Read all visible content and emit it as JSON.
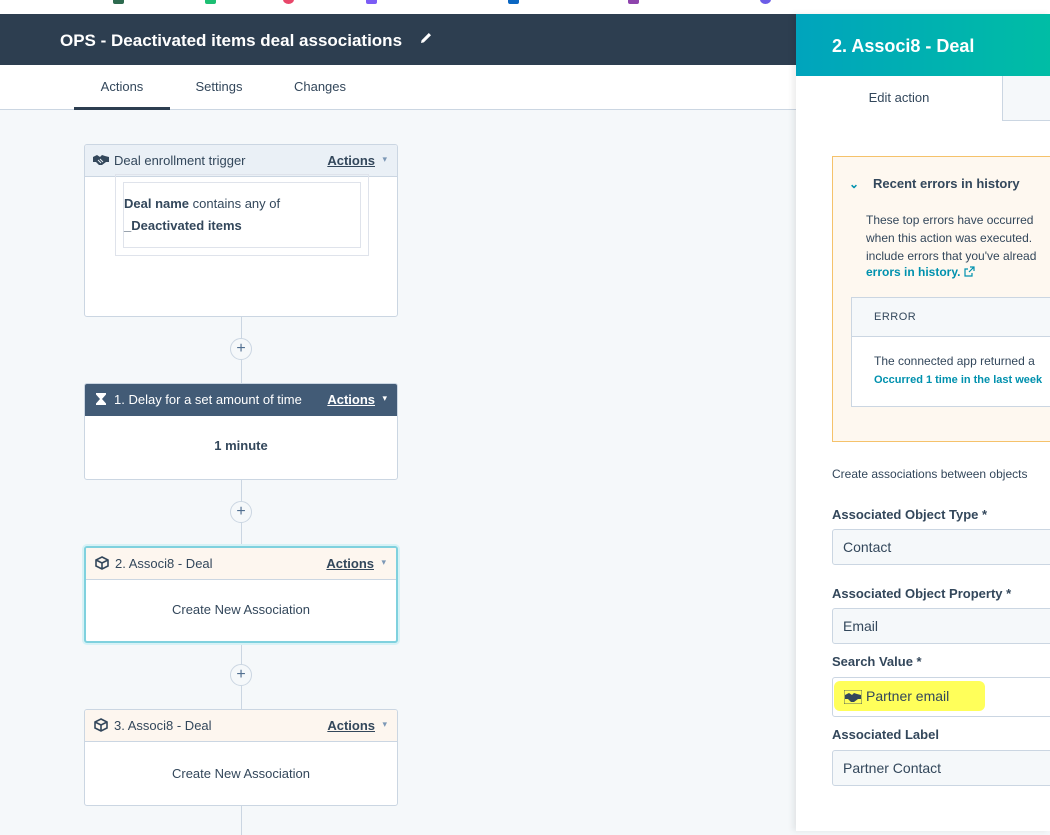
{
  "header": {
    "title": "OPS - Deactivated items deal associations"
  },
  "tabs": [
    {
      "label": "Actions"
    },
    {
      "label": "Settings"
    },
    {
      "label": "Changes"
    }
  ],
  "workflow": {
    "trigger": {
      "label": "Deal enrollment trigger",
      "actions_label": "Actions",
      "filter_property": "Deal name",
      "filter_operator": "contains any of",
      "filter_value": "_Deactivated items"
    },
    "step1": {
      "label": "1. Delay for a set amount of time",
      "actions_label": "Actions",
      "body": "1 minute"
    },
    "step2": {
      "label": "2. Associ8 - Deal",
      "actions_label": "Actions",
      "body": "Create New Association"
    },
    "step3": {
      "label": "3. Associ8 - Deal",
      "actions_label": "Actions",
      "body": "Create New Association"
    },
    "plus": "+"
  },
  "panel": {
    "title": "2. Associ8 - Deal",
    "tab_edit": "Edit action",
    "errors": {
      "title": "Recent errors in history",
      "lines": [
        "These top errors have occurred",
        "when this action was executed.",
        "include errors that you've alread"
      ],
      "link": "errors in history.",
      "column": "ERROR",
      "message": "The connected app returned a",
      "occurred": "Occurred 1 time in the last week"
    },
    "description": "Create associations between objects",
    "fields": {
      "object_type_label": "Associated Object Type *",
      "object_type_value": "Contact",
      "property_label": "Associated Object Property *",
      "property_value": "Email",
      "search_label": "Search Value *",
      "search_value": "Partner email",
      "assoc_label_label": "Associated Label",
      "assoc_label_value": "Partner Contact"
    }
  },
  "colors": {
    "header_bg": "#2d3e50",
    "panel_gradient_start": "#00a4bd",
    "panel_gradient_end": "#00bda5",
    "link": "#0091ae",
    "highlight": "#ffff3d"
  }
}
